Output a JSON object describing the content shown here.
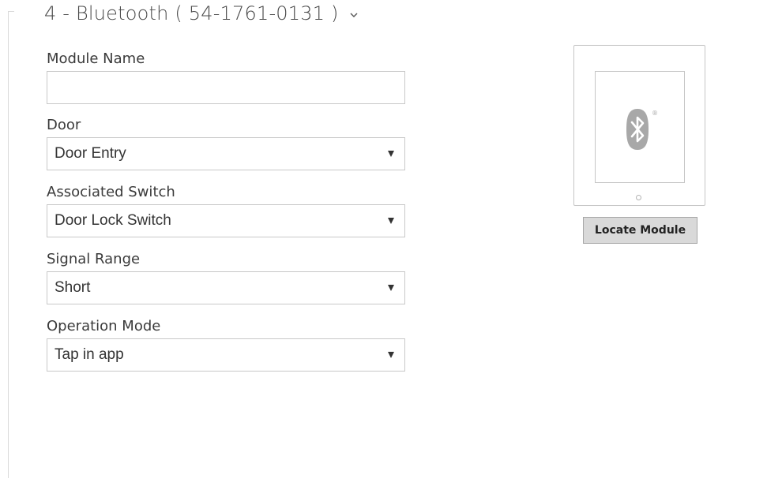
{
  "section": {
    "title": "4 - Bluetooth ( 54-1761-0131 )",
    "chevron_icon": "chevron-down-icon"
  },
  "form": {
    "module_name": {
      "label": "Module Name",
      "value": "",
      "placeholder": ""
    },
    "door": {
      "label": "Door",
      "value": "Door Entry"
    },
    "associated_switch": {
      "label": "Associated Switch",
      "value": "Door Lock Switch"
    },
    "signal_range": {
      "label": "Signal Range",
      "value": "Short"
    },
    "operation_mode": {
      "label": "Operation Mode",
      "value": "Tap in app"
    }
  },
  "device_preview": {
    "icon": "bluetooth-icon",
    "registered_mark": "®"
  },
  "locate_button": {
    "label": "Locate Module"
  },
  "colors": {
    "border": "#c8c8c8",
    "button_bg": "#d9d9d9",
    "icon_gray": "#a8a8a8"
  }
}
